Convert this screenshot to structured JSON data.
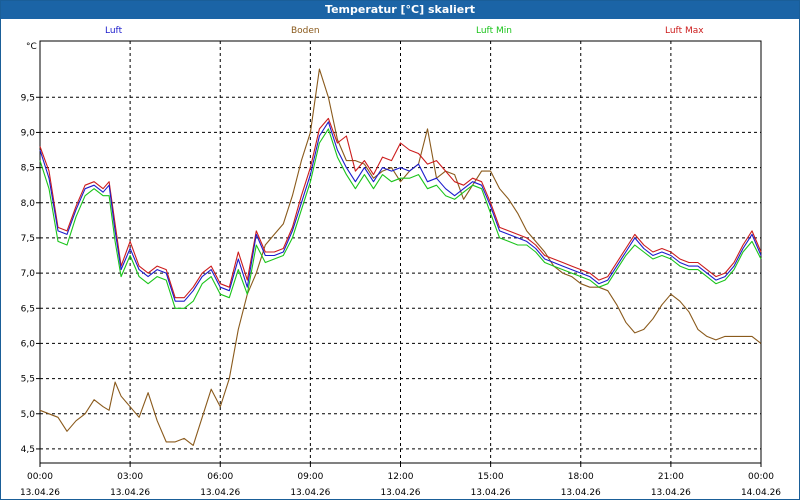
{
  "window": {
    "title": "Temperatur [°C] skaliert"
  },
  "chart_data": {
    "type": "line",
    "title": "Temperatur [°C] skaliert",
    "ylabel": "°C",
    "xlabel": "",
    "ylim": [
      4.3,
      10.3
    ],
    "xlim": [
      0,
      24
    ],
    "grid": true,
    "legend_position": "top",
    "y_ticks": [
      "4,5",
      "5,0",
      "5,5",
      "6,0",
      "6,5",
      "7,0",
      "7,5",
      "8,0",
      "8,5",
      "9,0",
      "9,5"
    ],
    "x_ticks": [
      {
        "time": "00:00",
        "date": "13.04.26"
      },
      {
        "time": "03:00",
        "date": "13.04.26"
      },
      {
        "time": "06:00",
        "date": "13.04.26"
      },
      {
        "time": "09:00",
        "date": "13.04.26"
      },
      {
        "time": "12:00",
        "date": "13.04.26"
      },
      {
        "time": "15:00",
        "date": "13.04.26"
      },
      {
        "time": "18:00",
        "date": "13.04.26"
      },
      {
        "time": "21:00",
        "date": "13.04.26"
      },
      {
        "time": "00:00",
        "date": "14.04.26"
      }
    ],
    "x_unit": "hours",
    "series": [
      {
        "name": "Luft",
        "color": "#1c1ccc",
        "x": [
          0,
          0.3,
          0.6,
          0.9,
          1.2,
          1.5,
          1.8,
          2.1,
          2.3,
          2.5,
          2.7,
          3.0,
          3.3,
          3.6,
          3.9,
          4.2,
          4.5,
          4.8,
          5.1,
          5.4,
          5.7,
          6.0,
          6.3,
          6.6,
          6.9,
          7.2,
          7.5,
          7.8,
          8.1,
          8.4,
          8.7,
          9.0,
          9.3,
          9.6,
          9.9,
          10.2,
          10.5,
          10.8,
          11.1,
          11.4,
          11.7,
          12.0,
          12.3,
          12.6,
          12.9,
          13.2,
          13.5,
          13.8,
          14.1,
          14.4,
          14.7,
          15.0,
          15.3,
          15.6,
          15.9,
          16.2,
          16.5,
          16.8,
          17.1,
          17.4,
          17.7,
          18.0,
          18.3,
          18.6,
          18.9,
          19.2,
          19.5,
          19.8,
          20.1,
          20.4,
          20.7,
          21.0,
          21.3,
          21.6,
          21.9,
          22.2,
          22.5,
          22.8,
          23.1,
          23.4,
          23.7,
          24.0
        ],
        "values": [
          8.75,
          8.35,
          7.6,
          7.55,
          7.9,
          8.2,
          8.25,
          8.15,
          8.25,
          7.6,
          7.05,
          7.35,
          7.05,
          6.95,
          7.05,
          7.0,
          6.6,
          6.6,
          6.75,
          6.95,
          7.05,
          6.8,
          6.75,
          7.2,
          6.8,
          7.55,
          7.25,
          7.25,
          7.3,
          7.6,
          8.0,
          8.4,
          8.95,
          9.15,
          8.75,
          8.5,
          8.3,
          8.5,
          8.3,
          8.5,
          8.45,
          8.5,
          8.45,
          8.55,
          8.3,
          8.35,
          8.2,
          8.1,
          8.2,
          8.3,
          8.25,
          7.95,
          7.6,
          7.55,
          7.5,
          7.45,
          7.35,
          7.2,
          7.15,
          7.1,
          7.05,
          7.0,
          6.95,
          6.85,
          6.9,
          7.1,
          7.3,
          7.5,
          7.35,
          7.25,
          7.3,
          7.25,
          7.15,
          7.1,
          7.1,
          7.0,
          6.9,
          6.95,
          7.1,
          7.35,
          7.55,
          7.25
        ]
      },
      {
        "name": "Boden",
        "color": "#8a5a1c",
        "x": [
          0,
          0.3,
          0.6,
          0.9,
          1.2,
          1.5,
          1.8,
          2.1,
          2.3,
          2.5,
          2.7,
          3.0,
          3.3,
          3.6,
          3.9,
          4.2,
          4.5,
          4.8,
          5.1,
          5.4,
          5.7,
          6.0,
          6.3,
          6.6,
          6.9,
          7.2,
          7.5,
          7.8,
          8.1,
          8.4,
          8.7,
          9.0,
          9.3,
          9.6,
          9.9,
          10.2,
          10.5,
          10.8,
          11.1,
          11.4,
          11.7,
          12.0,
          12.3,
          12.6,
          12.9,
          13.2,
          13.5,
          13.8,
          14.1,
          14.4,
          14.7,
          15.0,
          15.3,
          15.6,
          15.9,
          16.2,
          16.5,
          16.8,
          17.1,
          17.4,
          17.7,
          18.0,
          18.3,
          18.6,
          18.9,
          19.2,
          19.5,
          19.8,
          20.1,
          20.4,
          20.7,
          21.0,
          21.3,
          21.6,
          21.9,
          22.2,
          22.5,
          22.8,
          23.1,
          23.4,
          23.7,
          24.0
        ],
        "values": [
          5.05,
          5.0,
          4.95,
          4.75,
          4.9,
          5.0,
          5.2,
          5.1,
          5.05,
          5.45,
          5.25,
          5.1,
          4.95,
          5.3,
          4.9,
          4.6,
          4.6,
          4.65,
          4.55,
          4.95,
          5.35,
          5.1,
          5.5,
          6.2,
          6.7,
          7.0,
          7.4,
          7.55,
          7.7,
          8.1,
          8.6,
          9.0,
          9.9,
          9.5,
          8.9,
          8.6,
          8.6,
          8.55,
          8.35,
          8.45,
          8.5,
          8.3,
          8.45,
          8.55,
          9.05,
          8.35,
          8.45,
          8.4,
          8.05,
          8.25,
          8.45,
          8.45,
          8.2,
          8.05,
          7.85,
          7.6,
          7.45,
          7.3,
          7.1,
          7.0,
          6.95,
          6.85,
          6.8,
          6.8,
          6.75,
          6.55,
          6.3,
          6.15,
          6.2,
          6.35,
          6.55,
          6.7,
          6.6,
          6.45,
          6.2,
          6.1,
          6.05,
          6.1,
          6.1,
          6.1,
          6.1,
          6.0
        ]
      },
      {
        "name": "Luft Min",
        "color": "#1bc41b",
        "x": [
          0,
          0.3,
          0.6,
          0.9,
          1.2,
          1.5,
          1.8,
          2.1,
          2.3,
          2.5,
          2.7,
          3.0,
          3.3,
          3.6,
          3.9,
          4.2,
          4.5,
          4.8,
          5.1,
          5.4,
          5.7,
          6.0,
          6.3,
          6.6,
          6.9,
          7.2,
          7.5,
          7.8,
          8.1,
          8.4,
          8.7,
          9.0,
          9.3,
          9.6,
          9.9,
          10.2,
          10.5,
          10.8,
          11.1,
          11.4,
          11.7,
          12.0,
          12.3,
          12.6,
          12.9,
          13.2,
          13.5,
          13.8,
          14.1,
          14.4,
          14.7,
          15.0,
          15.3,
          15.6,
          15.9,
          16.2,
          16.5,
          16.8,
          17.1,
          17.4,
          17.7,
          18.0,
          18.3,
          18.6,
          18.9,
          19.2,
          19.5,
          19.8,
          20.1,
          20.4,
          20.7,
          21.0,
          21.3,
          21.6,
          21.9,
          22.2,
          22.5,
          22.8,
          23.1,
          23.4,
          23.7,
          24.0
        ],
        "values": [
          8.6,
          8.2,
          7.45,
          7.4,
          7.8,
          8.1,
          8.2,
          8.1,
          8.1,
          7.45,
          6.95,
          7.25,
          6.95,
          6.85,
          6.95,
          6.9,
          6.5,
          6.5,
          6.6,
          6.85,
          6.95,
          6.7,
          6.65,
          7.05,
          6.7,
          7.4,
          7.15,
          7.2,
          7.25,
          7.5,
          7.9,
          8.3,
          8.85,
          9.05,
          8.65,
          8.4,
          8.2,
          8.4,
          8.2,
          8.4,
          8.3,
          8.35,
          8.35,
          8.4,
          8.2,
          8.25,
          8.1,
          8.05,
          8.15,
          8.25,
          8.2,
          7.85,
          7.5,
          7.45,
          7.4,
          7.4,
          7.3,
          7.15,
          7.1,
          7.05,
          7.0,
          6.95,
          6.9,
          6.8,
          6.85,
          7.05,
          7.25,
          7.4,
          7.3,
          7.2,
          7.25,
          7.2,
          7.1,
          7.05,
          7.05,
          6.95,
          6.85,
          6.9,
          7.05,
          7.3,
          7.45,
          7.2
        ]
      },
      {
        "name": "Luft Max",
        "color": "#cc1c1c",
        "x": [
          0,
          0.3,
          0.6,
          0.9,
          1.2,
          1.5,
          1.8,
          2.1,
          2.3,
          2.5,
          2.7,
          3.0,
          3.3,
          3.6,
          3.9,
          4.2,
          4.5,
          4.8,
          5.1,
          5.4,
          5.7,
          6.0,
          6.3,
          6.6,
          6.9,
          7.2,
          7.5,
          7.8,
          8.1,
          8.4,
          8.7,
          9.0,
          9.3,
          9.6,
          9.9,
          10.2,
          10.5,
          10.8,
          11.1,
          11.4,
          11.7,
          12.0,
          12.3,
          12.6,
          12.9,
          13.2,
          13.5,
          13.8,
          14.1,
          14.4,
          14.7,
          15.0,
          15.3,
          15.6,
          15.9,
          16.2,
          16.5,
          16.8,
          17.1,
          17.4,
          17.7,
          18.0,
          18.3,
          18.6,
          18.9,
          19.2,
          19.5,
          19.8,
          20.1,
          20.4,
          20.7,
          21.0,
          21.3,
          21.6,
          21.9,
          22.2,
          22.5,
          22.8,
          23.1,
          23.4,
          23.7,
          24.0
        ],
        "values": [
          8.8,
          8.45,
          7.65,
          7.6,
          7.95,
          8.25,
          8.3,
          8.2,
          8.3,
          7.7,
          7.1,
          7.45,
          7.1,
          7.0,
          7.1,
          7.05,
          6.65,
          6.65,
          6.8,
          7.0,
          7.1,
          6.85,
          6.8,
          7.3,
          6.9,
          7.6,
          7.3,
          7.3,
          7.35,
          7.65,
          8.1,
          8.5,
          9.05,
          9.2,
          8.85,
          8.95,
          8.45,
          8.6,
          8.4,
          8.65,
          8.6,
          8.85,
          8.75,
          8.7,
          8.55,
          8.6,
          8.45,
          8.3,
          8.25,
          8.35,
          8.3,
          8.0,
          7.65,
          7.6,
          7.55,
          7.5,
          7.4,
          7.25,
          7.2,
          7.15,
          7.1,
          7.05,
          7.0,
          6.9,
          6.95,
          7.15,
          7.35,
          7.55,
          7.4,
          7.3,
          7.35,
          7.3,
          7.2,
          7.15,
          7.15,
          7.05,
          6.95,
          7.0,
          7.15,
          7.4,
          7.6,
          7.3
        ]
      }
    ]
  }
}
